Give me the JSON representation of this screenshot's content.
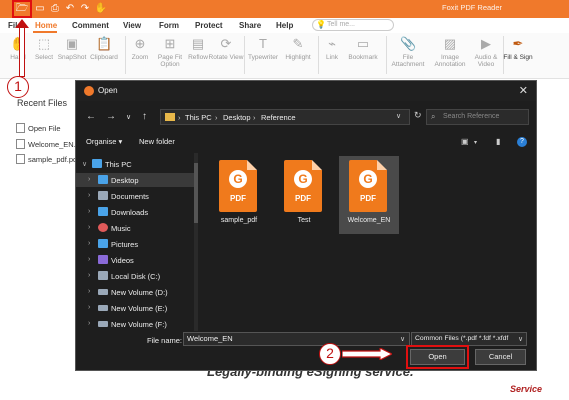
{
  "titlebar": {
    "title": "Foxit PDF Reader",
    "icons": [
      "open-folder-icon",
      "save-icon",
      "print-icon",
      "undo-icon",
      "redo-icon",
      "hand-icon"
    ]
  },
  "menu": {
    "items": [
      "File",
      "Home",
      "Comment",
      "View",
      "Form",
      "Protect",
      "Share",
      "Help"
    ],
    "active": "Home",
    "tell_me": "Tell me..."
  },
  "ribbon": {
    "buttons": [
      {
        "label": "Hand",
        "icon": "hand-icon"
      },
      {
        "label": "Select",
        "icon": "cursor-icon"
      },
      {
        "label": "SnapShot",
        "icon": "camera-icon"
      },
      {
        "label": "Clipboard",
        "icon": "clipboard-icon"
      },
      {
        "label": "Zoom",
        "icon": "zoom-icon"
      },
      {
        "label": "Page Fit Option",
        "icon": "page-fit-icon"
      },
      {
        "label": "Reflow",
        "icon": "reflow-icon"
      },
      {
        "label": "Rotate View",
        "icon": "rotate-icon"
      },
      {
        "label": "Typewriter",
        "icon": "typewriter-icon"
      },
      {
        "label": "Highlight",
        "icon": "highlight-icon"
      },
      {
        "label": "Link",
        "icon": "link-icon"
      },
      {
        "label": "Bookmark",
        "icon": "bookmark-icon"
      },
      {
        "label": "File Attachment",
        "icon": "attachment-icon"
      },
      {
        "label": "Image Annotation",
        "icon": "image-icon"
      },
      {
        "label": "Audio & Video",
        "icon": "media-icon"
      },
      {
        "label": "Fill & Sign",
        "icon": "pen-icon"
      }
    ]
  },
  "left_panel": {
    "title": "Recent Files",
    "items": [
      "Open File",
      "Welcome_EN...",
      "sample_pdf.pd..."
    ]
  },
  "background_doc": {
    "headline": "Legally-binding eSigning service.",
    "side_text": "Service"
  },
  "steps": {
    "one": "1",
    "two": "2"
  },
  "dialog": {
    "title": "Open",
    "breadcrumbs": [
      "This PC",
      "Desktop",
      "Reference"
    ],
    "search_placeholder": "Search Reference",
    "organise": "Organise ▾",
    "new_folder": "New folder",
    "tree": [
      {
        "label": "This PC",
        "icon": "pc-icon",
        "color": "#4aa3e8"
      },
      {
        "label": "Desktop",
        "icon": "desktop-icon",
        "color": "#4aa3e8"
      },
      {
        "label": "Documents",
        "icon": "documents-icon",
        "color": "#9aa8b8"
      },
      {
        "label": "Downloads",
        "icon": "downloads-icon",
        "color": "#4aa3e8"
      },
      {
        "label": "Music",
        "icon": "music-icon",
        "color": "#e05a5a"
      },
      {
        "label": "Pictures",
        "icon": "pictures-icon",
        "color": "#4aa3e8"
      },
      {
        "label": "Videos",
        "icon": "videos-icon",
        "color": "#8a6ad8"
      },
      {
        "label": "Local Disk (C:)",
        "icon": "disk-icon",
        "color": "#9aa8b8"
      },
      {
        "label": "New Volume (D:)",
        "icon": "drive-icon",
        "color": "#9aa8b8"
      },
      {
        "label": "New Volume (E:)",
        "icon": "drive-icon",
        "color": "#9aa8b8"
      },
      {
        "label": "New Volume (F:)",
        "icon": "drive-icon",
        "color": "#9aa8b8"
      }
    ],
    "files": [
      {
        "name": "sample_pdf",
        "badge": "PDF"
      },
      {
        "name": "Test",
        "badge": "PDF"
      },
      {
        "name": "Welcome_EN",
        "badge": "PDF"
      }
    ],
    "file_name_label": "File name:",
    "file_name_value": "Welcome_EN",
    "filter": "Common Files (*.pdf *.fdf *.xfdf",
    "open_label": "Open",
    "cancel_label": "Cancel"
  },
  "colors": {
    "accent": "#f0792b",
    "highlight": "#e01010",
    "dialog_bg": "#1e1e1e"
  }
}
